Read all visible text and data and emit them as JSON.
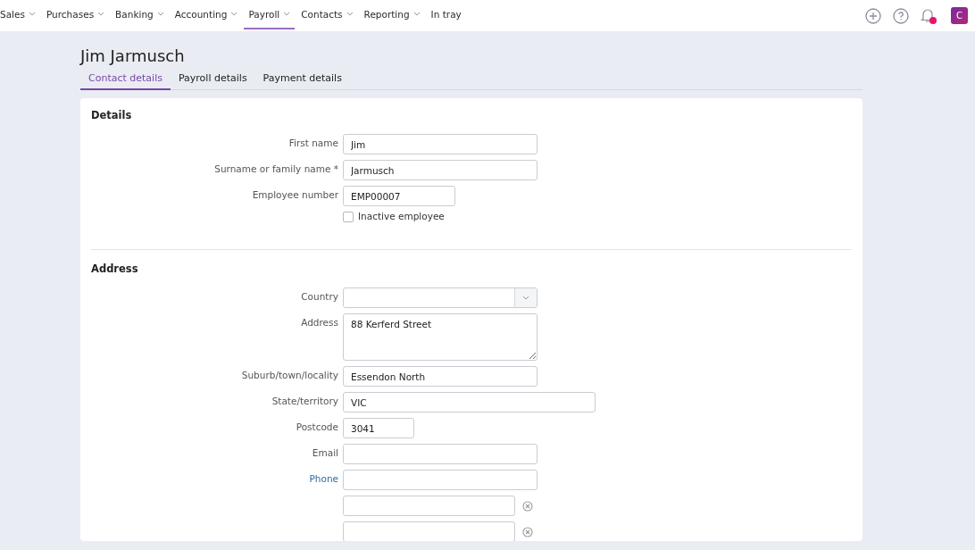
{
  "nav": {
    "items": [
      {
        "label": "Sales",
        "dropdown": true,
        "selected": false
      },
      {
        "label": "Purchases",
        "dropdown": true,
        "selected": false
      },
      {
        "label": "Banking",
        "dropdown": true,
        "selected": false
      },
      {
        "label": "Accounting",
        "dropdown": true,
        "selected": false
      },
      {
        "label": "Payroll",
        "dropdown": true,
        "selected": true
      },
      {
        "label": "Contacts",
        "dropdown": true,
        "selected": false
      },
      {
        "label": "Reporting",
        "dropdown": true,
        "selected": false
      },
      {
        "label": "In tray",
        "dropdown": false,
        "selected": false
      }
    ],
    "notification": true,
    "avatar": "C"
  },
  "title": "Jim Jarmusch",
  "tabs": [
    {
      "label": "Contact details",
      "selected": true
    },
    {
      "label": "Payroll details",
      "selected": false
    },
    {
      "label": "Payment details",
      "selected": false
    }
  ],
  "sections": [
    {
      "title": "Details",
      "fields": [
        {
          "kind": "text",
          "label": "First name",
          "value": "Jim"
        },
        {
          "kind": "text",
          "label": "Surname or family name",
          "required_mark": "*",
          "value": "Jarmusch"
        },
        {
          "kind": "text",
          "label": "Employee number",
          "value": "EMP00007"
        },
        {
          "kind": "checkbox",
          "label": "Inactive employee",
          "checked": false
        }
      ]
    },
    {
      "title": "Address",
      "fields": [
        {
          "kind": "select",
          "label": "Country"
        },
        {
          "kind": "textarea",
          "label": "Address",
          "value": "88 Kerferd Street"
        },
        {
          "kind": "text",
          "label": "Suburb/town/locality",
          "value": "Essendon North"
        },
        {
          "kind": "text",
          "label": "State/territory",
          "value": "VIC"
        },
        {
          "kind": "text",
          "label": "Postcode",
          "value": "3041"
        },
        {
          "kind": "text",
          "label": "Email"
        },
        {
          "kind": "link-text",
          "label": "Phone"
        },
        {
          "kind": "removable"
        },
        {
          "kind": "removable"
        }
      ]
    }
  ]
}
